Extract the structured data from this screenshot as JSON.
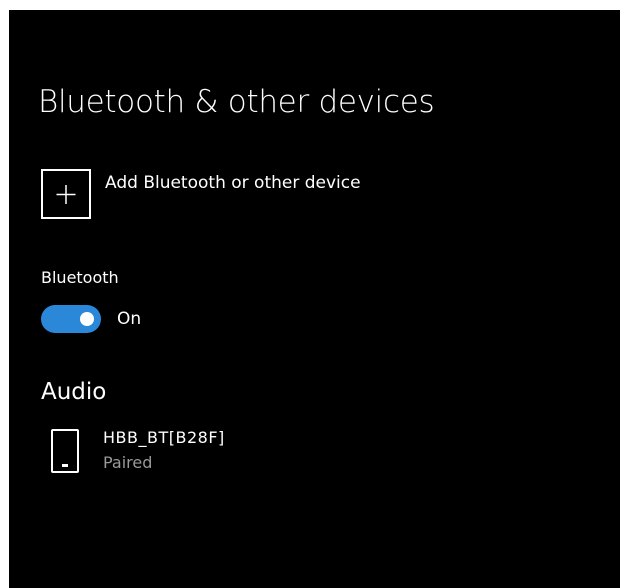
{
  "settings": {
    "page_title": "Bluetooth & other devices",
    "add_device_label": "Add Bluetooth or other device",
    "add_device_icon": "plus-icon",
    "bluetooth": {
      "section_label": "Bluetooth",
      "toggle_state": "On",
      "toggle_on": true,
      "accent_color": "#2b88d8"
    },
    "audio": {
      "heading": "Audio",
      "devices": [
        {
          "name": "HBB_BT[B28F]",
          "status": "Paired",
          "icon": "phone-icon"
        }
      ]
    }
  }
}
